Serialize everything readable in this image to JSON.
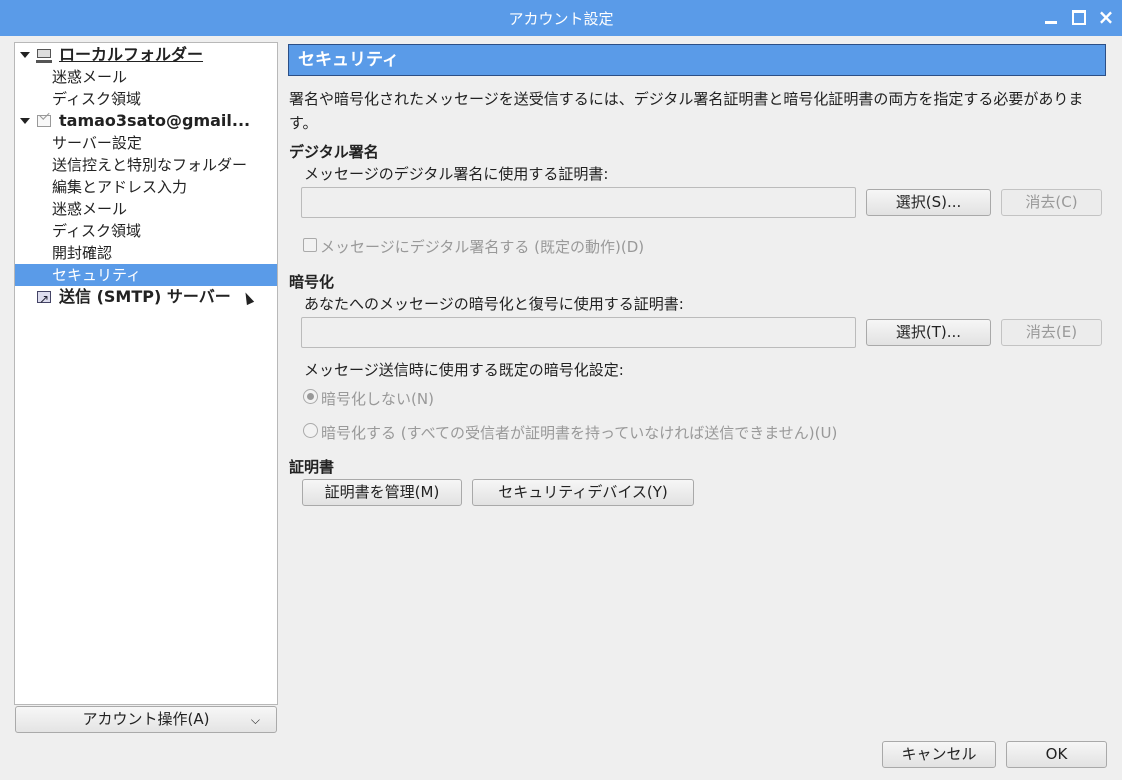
{
  "window": {
    "title": "アカウント設定"
  },
  "tree": {
    "items": [
      {
        "label": "ローカルフォルダー",
        "level": 0,
        "icon": "computer-icon",
        "expanded": true
      },
      {
        "label": "迷惑メール",
        "level": 1
      },
      {
        "label": "ディスク領域",
        "level": 1
      },
      {
        "label": "tamao3sato@gmail...",
        "level": 0,
        "icon": "mail-icon",
        "expanded": true
      },
      {
        "label": "サーバー設定",
        "level": 1
      },
      {
        "label": "送信控えと特別なフォルダー",
        "level": 1
      },
      {
        "label": "編集とアドレス入力",
        "level": 1
      },
      {
        "label": "迷惑メール",
        "level": 1
      },
      {
        "label": "ディスク領域",
        "level": 1
      },
      {
        "label": "開封確認",
        "level": 1
      },
      {
        "label": "セキュリティ",
        "level": 1,
        "selected": true
      },
      {
        "label": "送信 (SMTP) サーバー",
        "level": 0,
        "icon": "smtp-icon"
      }
    ]
  },
  "account_actions_label": "アカウント操作(A)",
  "panel": {
    "header": "セキュリティ",
    "description": "署名や暗号化されたメッセージを送受信するには、デジタル署名証明書と暗号化証明書の両方を指定する必要があります。",
    "signing": {
      "title": "デジタル署名",
      "cert_label": "メッセージのデジタル署名に使用する証明書:",
      "cert_value": "",
      "select_label": "選択(S)...",
      "clear_label": "消去(C)",
      "sign_checkbox_label": "メッセージにデジタル署名する (既定の動作)(D)",
      "sign_checked": false
    },
    "encryption": {
      "title": "暗号化",
      "cert_label": "あなたへのメッセージの暗号化と復号に使用する証明書:",
      "cert_value": "",
      "select_label": "選択(T)...",
      "clear_label": "消去(E)",
      "default_label": "メッセージ送信時に使用する既定の暗号化設定:",
      "option_none": "暗号化しない(N)",
      "option_required": "暗号化する (すべての受信者が証明書を持っていなければ送信できません)(U)",
      "selected_option": "none"
    },
    "certificates": {
      "title": "証明書",
      "manage_label": "証明書を管理(M)",
      "devices_label": "セキュリティデバイス(Y)"
    }
  },
  "footer": {
    "cancel_label": "キャンセル",
    "ok_label": "OK"
  },
  "colors": {
    "accent": "#5a9be8",
    "window_bg": "#efefef"
  }
}
